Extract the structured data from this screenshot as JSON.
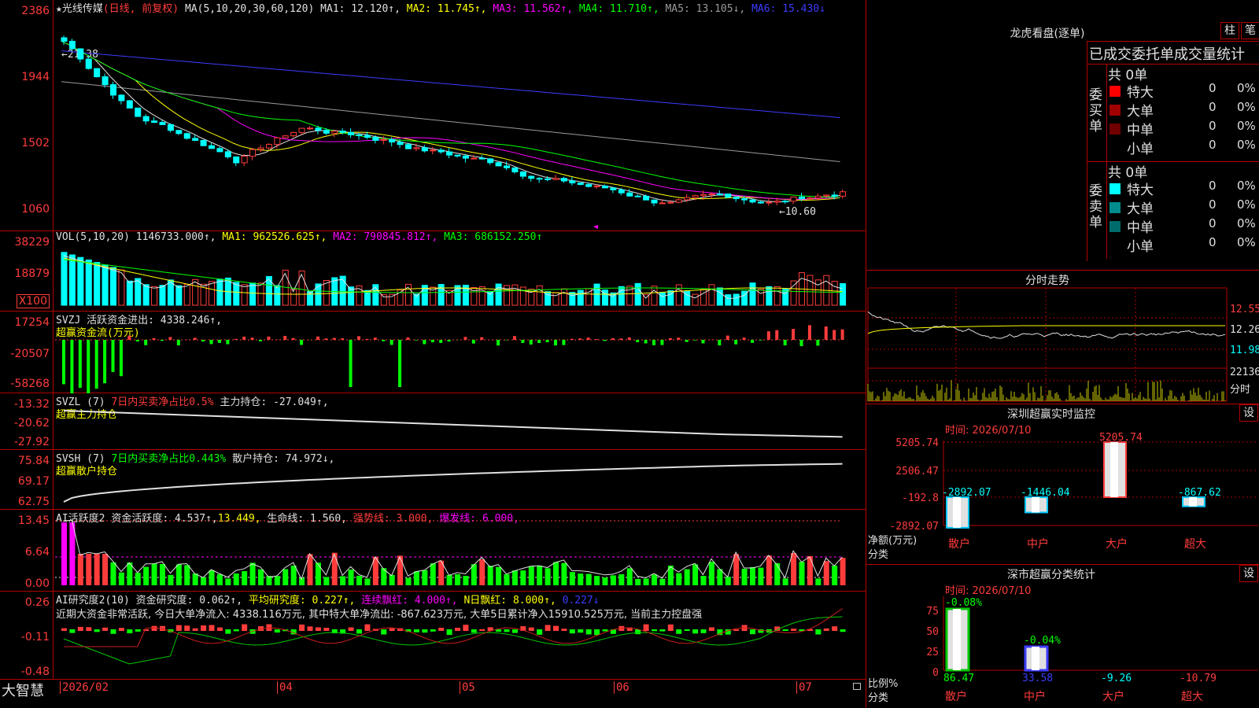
{
  "stock": {
    "name": "★光线传媒",
    "mode": "(日线, 前复权)"
  },
  "main": {
    "ma_label": "MA(5,10,20,30,60,120)",
    "ma1": "MA1: 12.120↑,",
    "ma2": "MA2: 11.745↑,",
    "ma3": "MA3: 11.562↑,",
    "ma4": "MA4: 11.710↑,",
    "ma5": "MA5: 13.105↓,",
    "ma6": "MA6: 15.430↓",
    "y_labels": [
      "2386",
      "1944",
      "1502",
      "1060"
    ],
    "hi_mark": "←21.38",
    "lo_mark": "←10.60"
  },
  "vol": {
    "label": "VOL(5,10,20)",
    "value": "1146733.000↑,",
    "ma1": "MA1: 962526.625↑,",
    "ma2": "MA2: 790845.812↑,",
    "ma3": "MA3: 686152.250↑",
    "y_labels": [
      "38229",
      "18879"
    ],
    "unit": "X100"
  },
  "svzj": {
    "label": "SVZJ",
    "title": "活跃资金进出: 4338.246↑,",
    "sub": "超赢资金流(万元)",
    "y_labels": [
      "17254",
      "-20507",
      "-58268"
    ]
  },
  "svzl": {
    "label": "SVZL (7)",
    "note": "7日内买卖净占比0.5%",
    "title": "主力持仓: -27.049↑,",
    "sub": "超赢主力持仓",
    "y_labels": [
      "-13.32",
      "-20.62",
      "-27.92"
    ]
  },
  "svsh": {
    "label": "SVSH (7)",
    "note": "7日内买卖净占比0.443%",
    "title": "散户持仓: 74.972↓,",
    "sub": "超赢散户持仓",
    "y_labels": [
      "75.84",
      "69.17",
      "62.75"
    ]
  },
  "ai1": {
    "label": "AI活跃度2",
    "a": "资金活跃度: 4.537↑,",
    "b": "13.449,",
    "c": "生命线: 1.560,",
    "d": "强势线: 3.000,",
    "e": "爆发线: 6.000,",
    "y_labels": [
      "13.45",
      "6.64",
      "0.00"
    ]
  },
  "ai2": {
    "label": "AI研究度2(10)",
    "a": "资金研究度: 0.062↑,",
    "b": "平均研究度: 0.227↑,",
    "c": "连续飘红: 4.000↑,",
    "d": "N日飘红: 8.000↑,",
    "e": "0.227↓",
    "msg": "近期大资金非常活跃, 今日大单净流入: 4338.116万元, 其中特大单净流出: -867.623万元, 大单5日累计净入15910.525万元, 当前主力控盘强",
    "y_labels": [
      "0.26",
      "-0.11",
      "-0.48"
    ]
  },
  "xaxis": {
    "logo": "大智慧",
    "labels": [
      "2026/02",
      "04",
      "05",
      "06",
      "07"
    ]
  },
  "lhb": {
    "title": "龙虎看盘(逐单)",
    "btn1": "柱",
    "btn2": "笔",
    "subtitle": "已成交委托单成交量统计",
    "buy": {
      "label": "委买单",
      "total": "共 0单",
      "rows": [
        {
          "name": "特大",
          "n": "0",
          "p": "0%",
          "color": "#ff0000"
        },
        {
          "name": "大单",
          "n": "0",
          "p": "0%",
          "color": "#a00000"
        },
        {
          "name": "中单",
          "n": "0",
          "p": "0%",
          "color": "#700000"
        },
        {
          "name": "小单",
          "n": "0",
          "p": "0%",
          "color": "#000"
        }
      ]
    },
    "sell": {
      "label": "委卖单",
      "total": "共 0单",
      "rows": [
        {
          "name": "特大",
          "n": "0",
          "p": "0%",
          "color": "#00ffff"
        },
        {
          "name": "大单",
          "n": "0",
          "p": "0%",
          "color": "#008c8c"
        },
        {
          "name": "中单",
          "n": "0",
          "p": "0%",
          "color": "#006c6c"
        },
        {
          "name": "小单",
          "n": "0",
          "p": "0%",
          "color": "#000"
        }
      ]
    }
  },
  "fs": {
    "title": "分时走势",
    "y_labels": [
      "12.55",
      "12.26",
      "11.98"
    ],
    "vol_label": "22136",
    "unit": "分时"
  },
  "szmon": {
    "title": "深圳超赢实时监控",
    "btn": "设",
    "date": "时间: 2026/07/10",
    "y_labels": [
      "5205.74",
      "2506.47",
      "-192.8",
      "-2892.07"
    ],
    "ylab": "净额(万元)",
    "xlab": "分类",
    "bars": [
      {
        "name": "散户",
        "val": "-2892.07",
        "color": "#00c8ff"
      },
      {
        "name": "中户",
        "val": "-1446.04",
        "color": "#00c8ff"
      },
      {
        "name": "大户",
        "val": "5205.74",
        "color": "#ff3c3c"
      },
      {
        "name": "超大",
        "val": "-867.62",
        "color": "#00c8ff"
      }
    ]
  },
  "szcls": {
    "title": "深市超赢分类统计",
    "btn": "设",
    "date": "时间: 2026/07/10",
    "y_labels": [
      "75",
      "50",
      "25",
      "0"
    ],
    "ylab": "比例%",
    "xlab": "分类",
    "tops": [
      "-0.08%",
      "-0.04%"
    ],
    "bars": [
      {
        "name": "散户",
        "val": "86.47"
      },
      {
        "name": "中户",
        "val": "33.58"
      },
      {
        "name": "大户",
        "val": "-9.26"
      },
      {
        "name": "超大",
        "val": "-10.79"
      }
    ]
  }
}
